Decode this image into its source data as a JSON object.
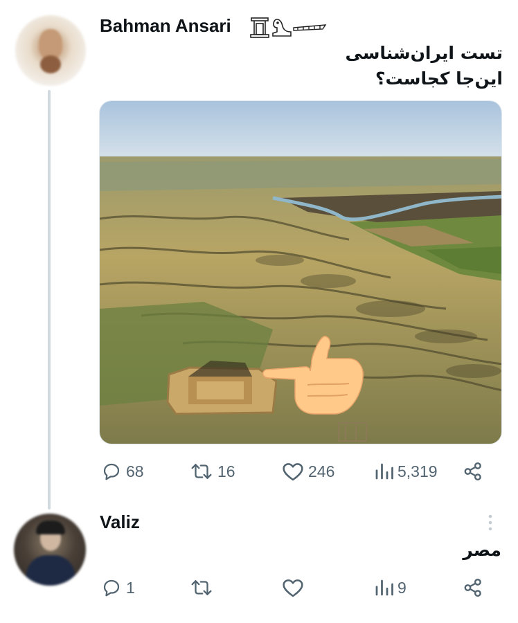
{
  "post": {
    "author": "Bahman Ansari",
    "author_emoji_icons": [
      "classical-building-icon",
      "sphinx-icon",
      "feather-icon"
    ],
    "text_line1": "تست ایران‌شناسی",
    "text_line2": "این‌جا کجاست؟",
    "image": "aerial-view-ziggurat-landscape-image",
    "overlay": "pointing-hand-emoji",
    "stats": {
      "replies": "68",
      "reposts": "16",
      "likes": "246",
      "views": "5,319"
    }
  },
  "reply": {
    "author": "Valiz",
    "text": "مصر",
    "stats": {
      "replies": "1",
      "reposts": "",
      "likes": "",
      "views": "9"
    }
  },
  "colors": {
    "text": "#0f1419",
    "secondary": "#536471",
    "thread_line": "#cfd9de"
  }
}
